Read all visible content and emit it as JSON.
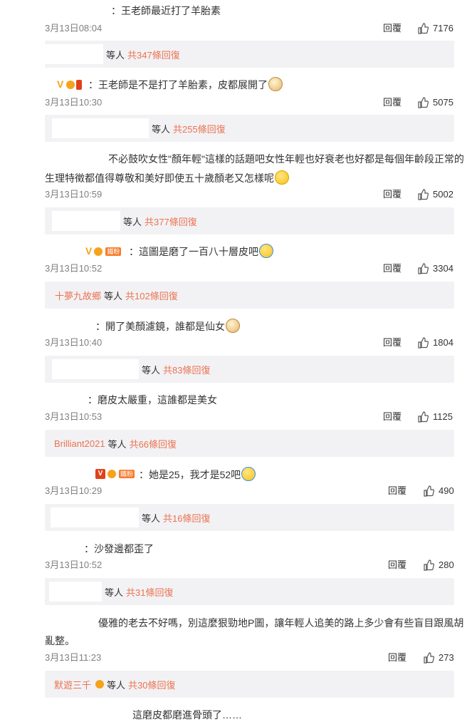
{
  "comments": [
    {
      "text": "：王老師最近打了羊胎素",
      "time": "3月13日08:04",
      "reply": "回覆",
      "likes": "7176",
      "sub": {
        "name": "",
        "suffix": "等人",
        "count": "共347條回復"
      }
    },
    {
      "text": "：王老師是不是打了羊胎素，皮都展開了",
      "time": "3月13日10:30",
      "reply": "回覆",
      "likes": "5075",
      "sub": {
        "name": "",
        "suffix": "等人",
        "count": "共255條回復"
      }
    },
    {
      "text_line1": "不必鼓吹女性\"顏年輕\"這樣的話題吧女性年輕也好衰老也好都是每個年齡段正常的",
      "text_line2": "生理特徵都值得尊敬和美好即使五十歲顏老又怎樣呢",
      "time": "3月13日10:59",
      "reply": "回覆",
      "likes": "5002",
      "sub": {
        "name": "",
        "suffix": "等人",
        "count": "共377條回復"
      }
    },
    {
      "badge_fan": "鐵粉",
      "text": "：這圖是磨了一百八十層皮吧",
      "time": "3月13日10:52",
      "reply": "回覆",
      "likes": "3304",
      "sub": {
        "name": "十夢九故鄉",
        "suffix": "等人",
        "count": "共102條回復"
      }
    },
    {
      "text": "：開了美顏濾鏡，誰都是仙女",
      "time": "3月13日10:40",
      "reply": "回覆",
      "likes": "1804",
      "sub": {
        "name": "",
        "suffix": "等人",
        "count": "共83條回復"
      }
    },
    {
      "text": "：磨皮太嚴重，這誰都是美女",
      "time": "3月13日10:53",
      "reply": "回覆",
      "likes": "1125",
      "sub": {
        "name": "Brilliant2021",
        "suffix": "等人",
        "count": "共66條回復"
      }
    },
    {
      "badge_fan": "鐵粉",
      "text": "：她是25，我才是52吧",
      "time": "3月13日10:29",
      "reply": "回覆",
      "likes": "490",
      "sub": {
        "name": "",
        "suffix": "等人",
        "count": "共16條回復"
      }
    },
    {
      "text": "：沙發邊都歪了",
      "time": "3月13日10:52",
      "reply": "回覆",
      "likes": "280",
      "sub": {
        "name": "",
        "suffix": "等人",
        "count": "共31條回復"
      }
    },
    {
      "text_line1": "優雅的老去不好嗎，別這麼狠勁地P圖，讓年輕人追美的路上多少會有些盲目跟風胡",
      "text_line2": "亂整。",
      "time": "3月13日11:23",
      "reply": "回覆",
      "likes": "273",
      "sub": {
        "name": "默遊三千",
        "suffix": "等人",
        "count": "共30條回復"
      }
    },
    {
      "text": "這磨皮都磨進骨頭了……"
    }
  ],
  "icons": {
    "like": "thumbs-up-icon",
    "verified": "v-badge-icon"
  },
  "colors": {
    "accent": "#eb7350",
    "muted": "#808080",
    "subbar_bg": "#f2f2f5"
  }
}
